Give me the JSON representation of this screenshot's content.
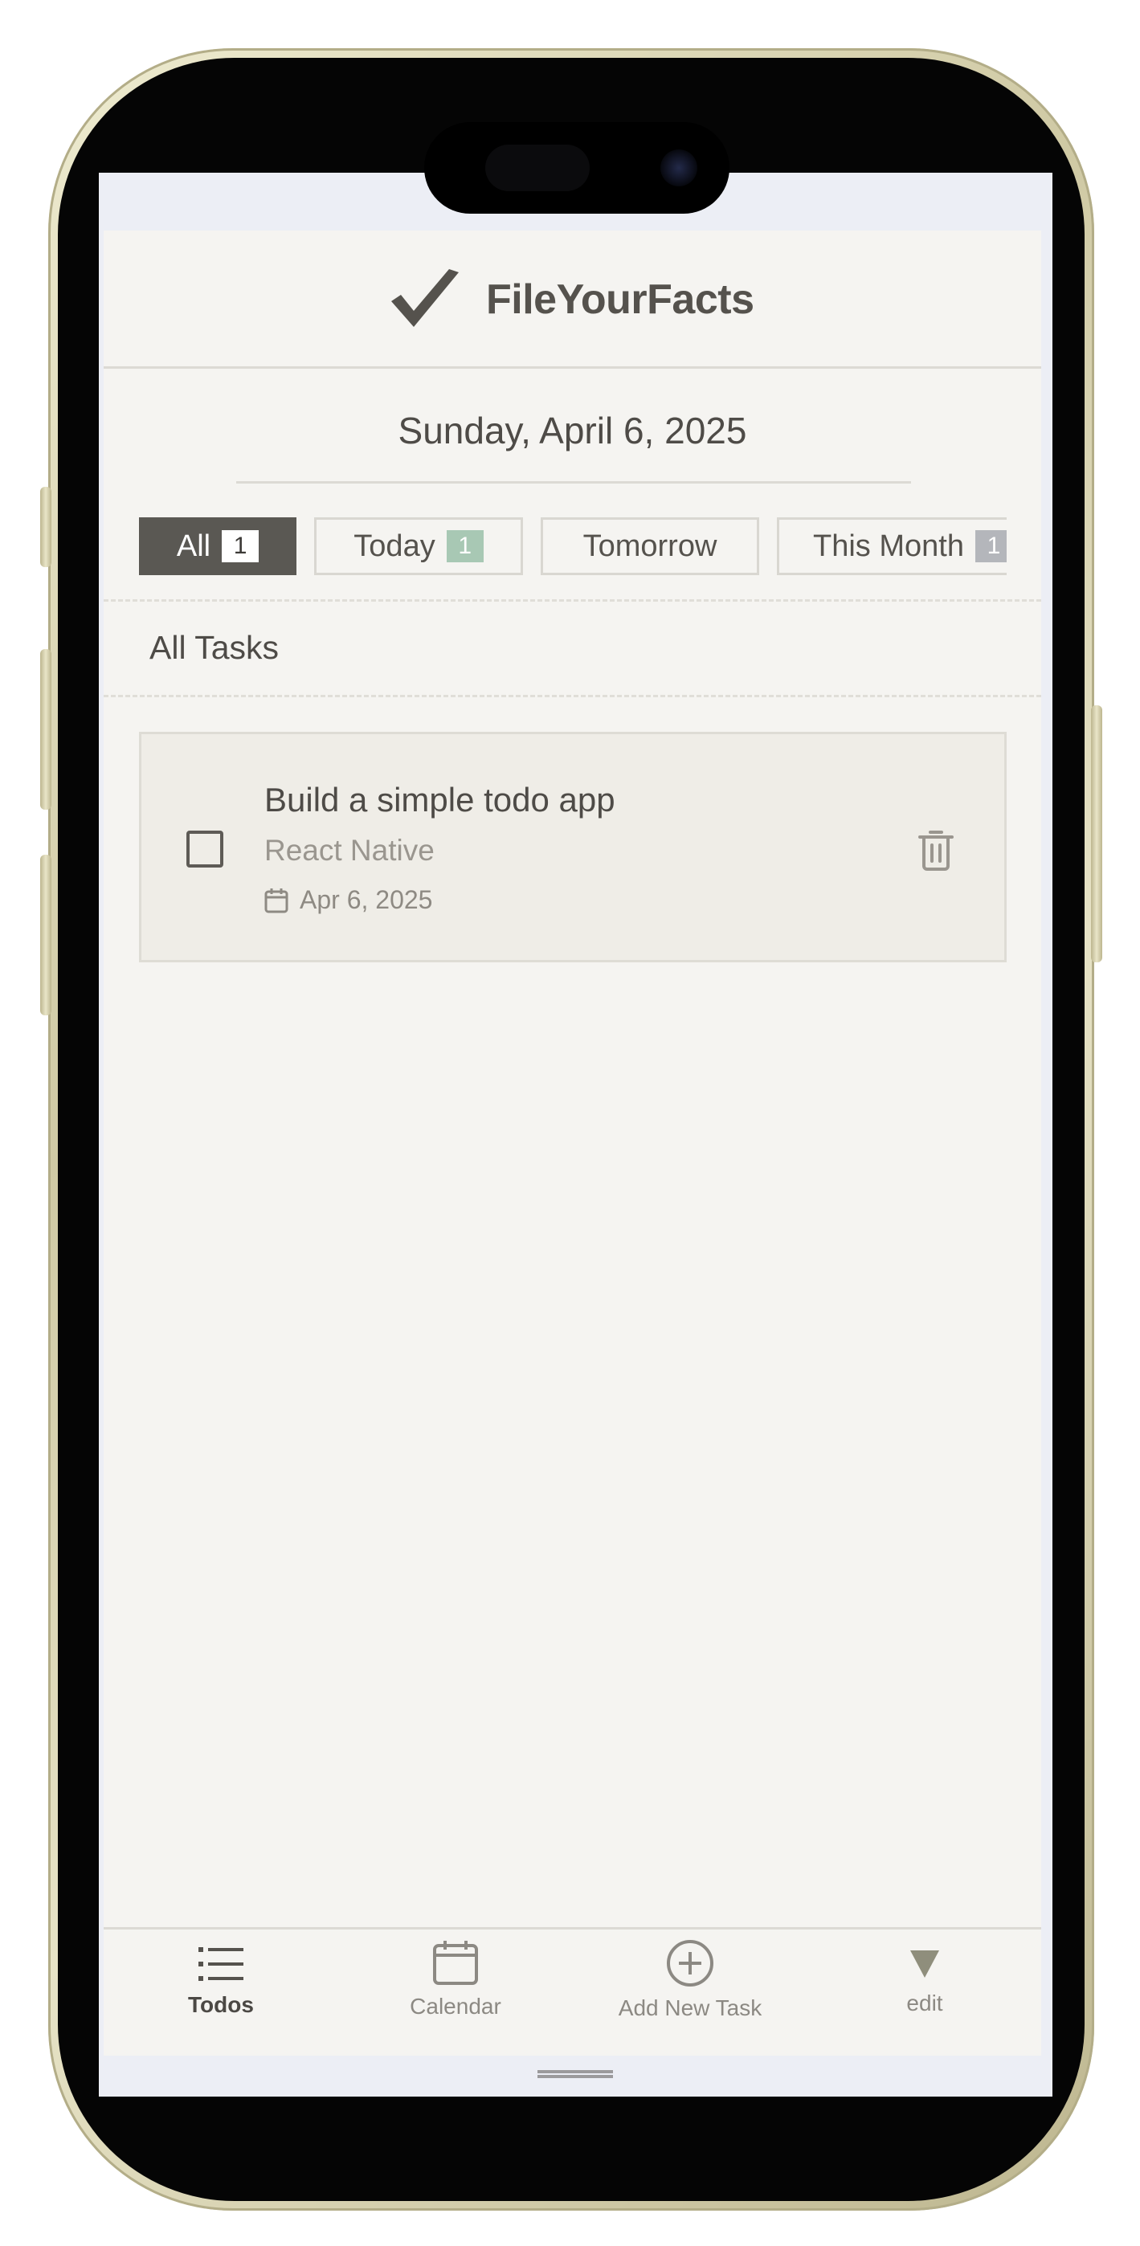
{
  "app": {
    "title": "FileYourFacts",
    "logo_icon": "checkmark-icon"
  },
  "date_heading": "Sunday, April 6, 2025",
  "filters": [
    {
      "label": "All",
      "count": "1",
      "active": true
    },
    {
      "label": "Today",
      "count": "1"
    },
    {
      "label": "Tomorrow"
    },
    {
      "label": "This Month",
      "count": "1"
    }
  ],
  "section_title": "All Tasks",
  "task": {
    "title": "Build a simple todo app",
    "category": "React Native",
    "date": "Apr 6, 2025",
    "date_icon": "calendar-icon",
    "delete_icon": "trash-icon"
  },
  "tabs": [
    {
      "label": "Todos",
      "icon": "list-icon",
      "active": true
    },
    {
      "label": "Calendar",
      "icon": "calendar-icon"
    },
    {
      "label": "Add New Task",
      "icon": "plus-circle-icon"
    },
    {
      "label": "edit",
      "icon": "triangle-down-icon"
    }
  ],
  "colors": {
    "background": "#f5f4f1",
    "active_chip": "#5a5853",
    "today_badge": "#a8c8b4",
    "month_badge": "#b4b6bb",
    "text": "#4e4b47"
  }
}
